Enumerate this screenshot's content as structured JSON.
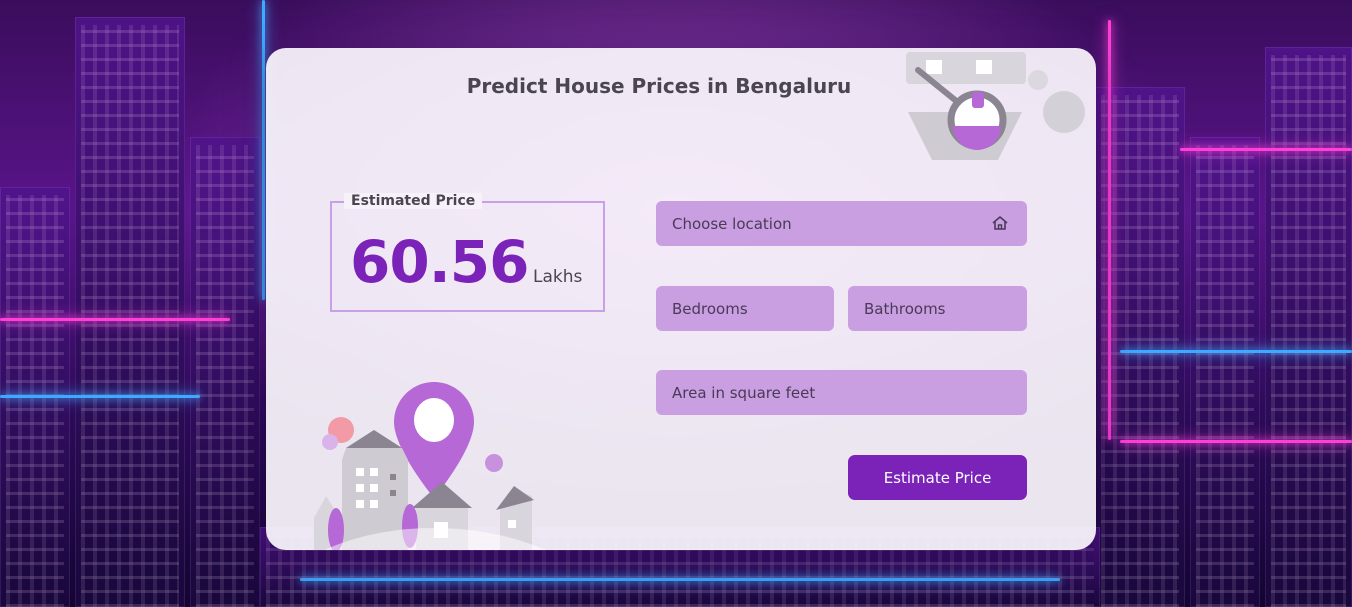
{
  "header": {
    "title": "Predict House Prices in Bengaluru"
  },
  "estimate": {
    "legend": "Estimated Price",
    "value": "60.56",
    "unit": "Lakhs"
  },
  "form": {
    "location_placeholder": "Choose location",
    "bedrooms_placeholder": "Bedrooms",
    "bathrooms_placeholder": "Bathrooms",
    "area_placeholder": "Area in square feet",
    "submit_label": "Estimate Price"
  },
  "icons": {
    "location_field_icon": "home-icon",
    "top_illustration": "magnifier-sink-icon",
    "bottom_illustration": "location-pin-buildings-icon"
  },
  "colors": {
    "accent": "#7b22b8",
    "field_fill": "#c99fe2",
    "card_bg": "#faf6fc",
    "text": "#4a4550"
  }
}
